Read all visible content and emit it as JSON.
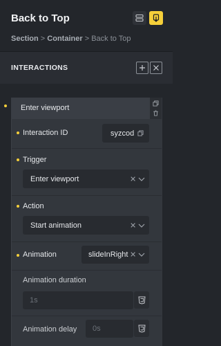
{
  "header": {
    "title": "Back to Top",
    "breadcrumb": {
      "section": "Section",
      "separator": ">",
      "container": "Container",
      "current": "Back to Top"
    }
  },
  "interactions": {
    "title": "INTERACTIONS"
  },
  "item": {
    "label": "Enter viewport",
    "fields": {
      "interaction_id": {
        "label": "Interaction ID",
        "value": "syzcod"
      },
      "trigger": {
        "label": "Trigger",
        "value": "Enter viewport"
      },
      "action": {
        "label": "Action",
        "value": "Start animation"
      },
      "animation": {
        "label": "Animation",
        "value": "slideInRight"
      },
      "duration": {
        "label": "Animation duration",
        "placeholder": "1s"
      },
      "delay": {
        "label": "Animation delay",
        "placeholder": "0s"
      }
    }
  },
  "colors": {
    "accent": "#f5cf3a",
    "background": "#23262b",
    "card": "#33373d",
    "field": "#282b30"
  },
  "icons": {
    "structure": "structure-icon",
    "target": "target-icon",
    "add": "plus-icon",
    "close": "close-icon",
    "copy": "copy-icon",
    "delete": "trash-icon",
    "clear": "clear-x-icon",
    "dropdown": "chevron-down-icon",
    "css": "css3-icon"
  }
}
